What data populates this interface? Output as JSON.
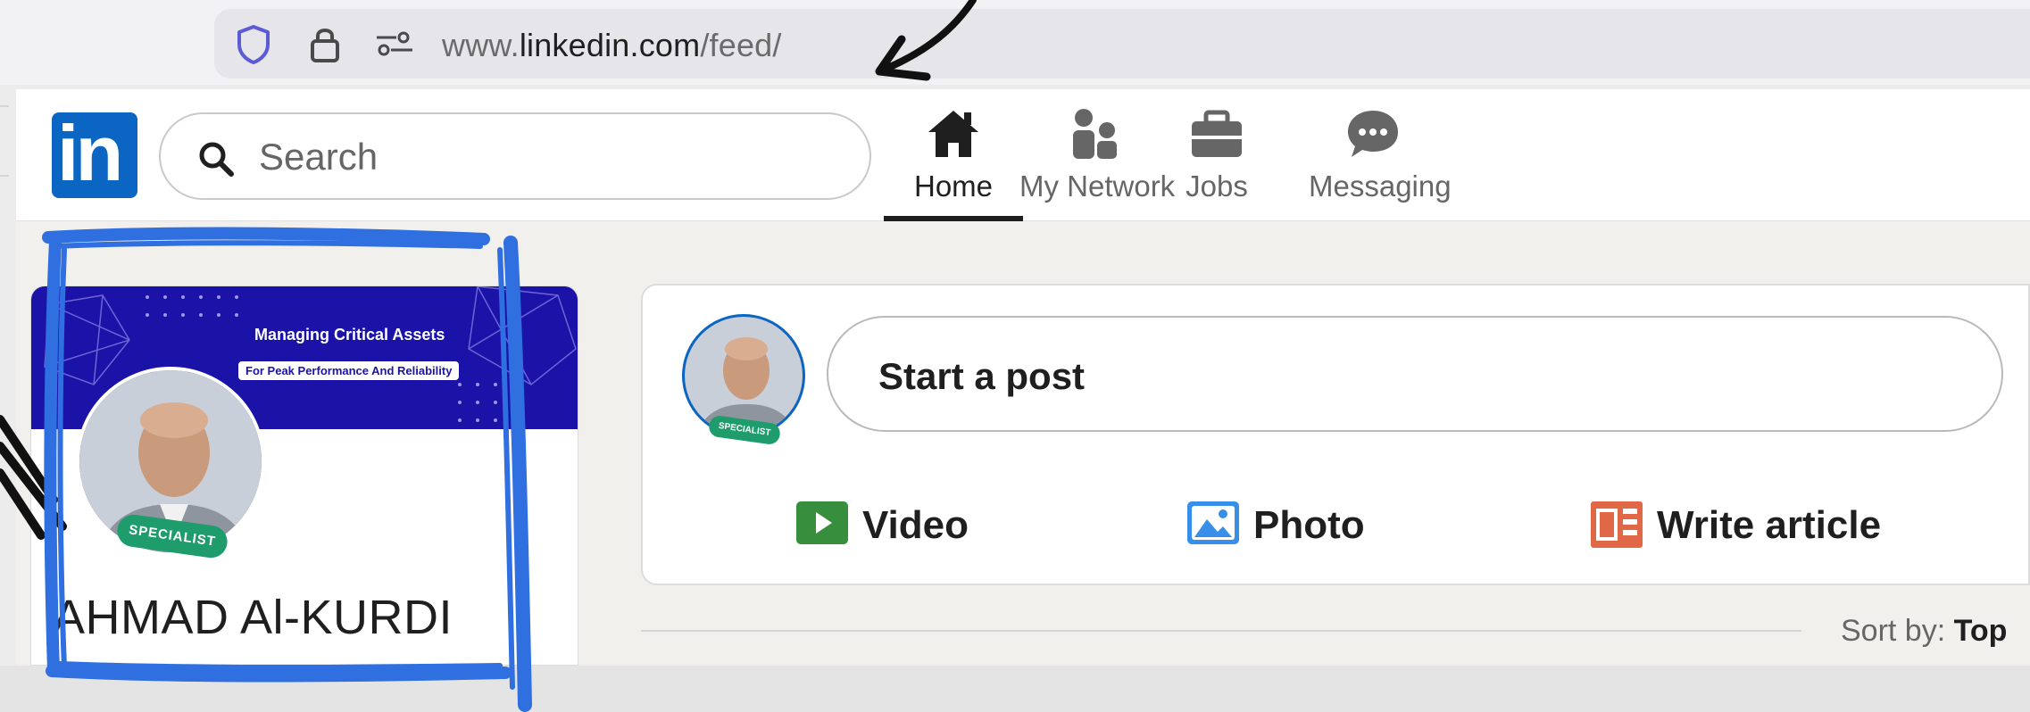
{
  "browser": {
    "url_prefix": "www.",
    "url_domain": "linkedin.com",
    "url_path": "/feed/",
    "icons": [
      "shield-icon",
      "lock-icon",
      "site-settings-icon"
    ]
  },
  "navbar": {
    "logo_text": "in",
    "search_placeholder": "Search",
    "items": [
      {
        "label": "Home",
        "icon": "home-icon",
        "active": true
      },
      {
        "label": "My Network",
        "icon": "network-icon",
        "active": false
      },
      {
        "label": "Jobs",
        "icon": "briefcase-icon",
        "active": false
      },
      {
        "label": "Messaging",
        "icon": "chat-icon",
        "active": false
      }
    ]
  },
  "profile": {
    "cover_title": "Managing Critical Assets",
    "cover_subtitle": "For Peak Performance And Reliability",
    "badge": "SPECIALIST",
    "name": "AHMAD Al-KURDI"
  },
  "post_box": {
    "badge": "SPECIALIST",
    "prompt": "Start a post",
    "actions": [
      {
        "label": "Video",
        "icon": "video-icon",
        "color": "#378f3d"
      },
      {
        "label": "Photo",
        "icon": "photo-icon",
        "color": "#378fe9"
      },
      {
        "label": "Write article",
        "icon": "article-icon",
        "color": "#e06847"
      }
    ]
  },
  "feed": {
    "sort_prefix": "Sort by: ",
    "sort_value": "Top"
  },
  "colors": {
    "linkedin_blue": "#0a66c2",
    "annotation_blue": "#2f6fe0",
    "cover_blue": "#1b12a8"
  }
}
